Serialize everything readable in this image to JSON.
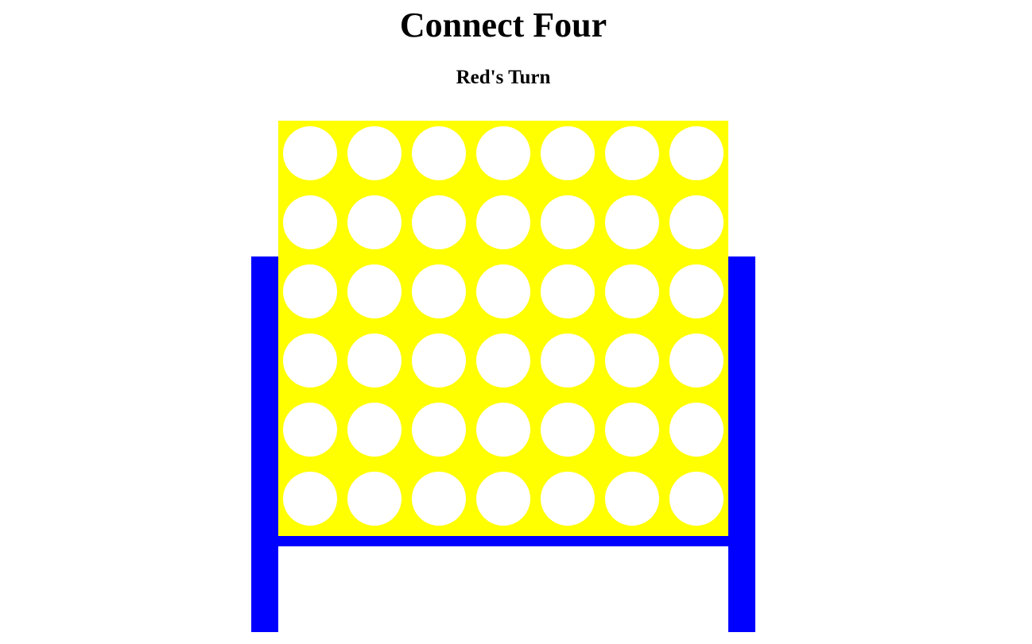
{
  "game": {
    "title": "Connect Four",
    "status": "Red's Turn"
  },
  "board": {
    "columns": 7,
    "rows": 6,
    "cells": [
      [
        "empty",
        "empty",
        "empty",
        "empty",
        "empty",
        "empty",
        "empty"
      ],
      [
        "empty",
        "empty",
        "empty",
        "empty",
        "empty",
        "empty",
        "empty"
      ],
      [
        "empty",
        "empty",
        "empty",
        "empty",
        "empty",
        "empty",
        "empty"
      ],
      [
        "empty",
        "empty",
        "empty",
        "empty",
        "empty",
        "empty",
        "empty"
      ],
      [
        "empty",
        "empty",
        "empty",
        "empty",
        "empty",
        "empty",
        "empty"
      ],
      [
        "empty",
        "empty",
        "empty",
        "empty",
        "empty",
        "empty",
        "empty"
      ]
    ]
  },
  "colors": {
    "board": "#ffff00",
    "stand": "#0000ff",
    "empty_slot": "#ffffff",
    "red_piece": "#ff0000",
    "yellow_piece": "#ffd700"
  }
}
